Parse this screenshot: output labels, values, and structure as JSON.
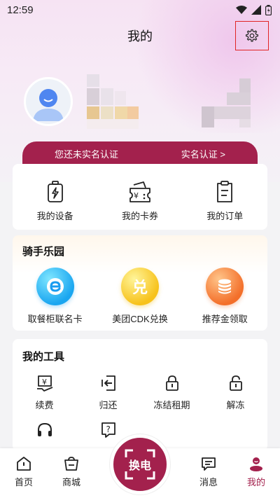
{
  "status_bar": {
    "time": "12:59"
  },
  "header": {
    "title": "我的"
  },
  "realname": {
    "notice": "您还未实名认证",
    "action": "实名认证 >"
  },
  "quick_actions": [
    {
      "label": "我的设备",
      "icon": "battery-icon"
    },
    {
      "label": "我的卡券",
      "icon": "coupon-icon"
    },
    {
      "label": "我的订单",
      "icon": "order-icon"
    }
  ],
  "rider_park": {
    "title": "骑手乐园",
    "items": [
      {
        "label": "取餐柜联名卡",
        "icon": "e-logo-icon"
      },
      {
        "label": "美团CDK兑换",
        "icon": "redeem-icon",
        "glyph": "兑"
      },
      {
        "label": "推荐金领取",
        "icon": "coin-stack-icon"
      }
    ]
  },
  "tools": {
    "title": "我的工具",
    "items": [
      {
        "label": "续费",
        "icon": "renew-icon"
      },
      {
        "label": "归还",
        "icon": "return-icon"
      },
      {
        "label": "冻结租期",
        "icon": "freeze-lock-icon"
      },
      {
        "label": "解冻",
        "icon": "unfreeze-lock-icon"
      },
      {
        "label": "",
        "icon": "headset-icon"
      },
      {
        "label": "",
        "icon": "help-icon"
      }
    ]
  },
  "tabbar": {
    "items": [
      {
        "label": "首页",
        "icon": "home-icon"
      },
      {
        "label": "商城",
        "icon": "shop-icon"
      },
      {
        "label": "消息",
        "icon": "message-icon"
      },
      {
        "label": "我的",
        "icon": "profile-icon"
      }
    ],
    "center": {
      "label": "换电"
    },
    "active": "我的"
  },
  "colors": {
    "accent": "#a3214d",
    "highlight_box": "#e02424"
  }
}
